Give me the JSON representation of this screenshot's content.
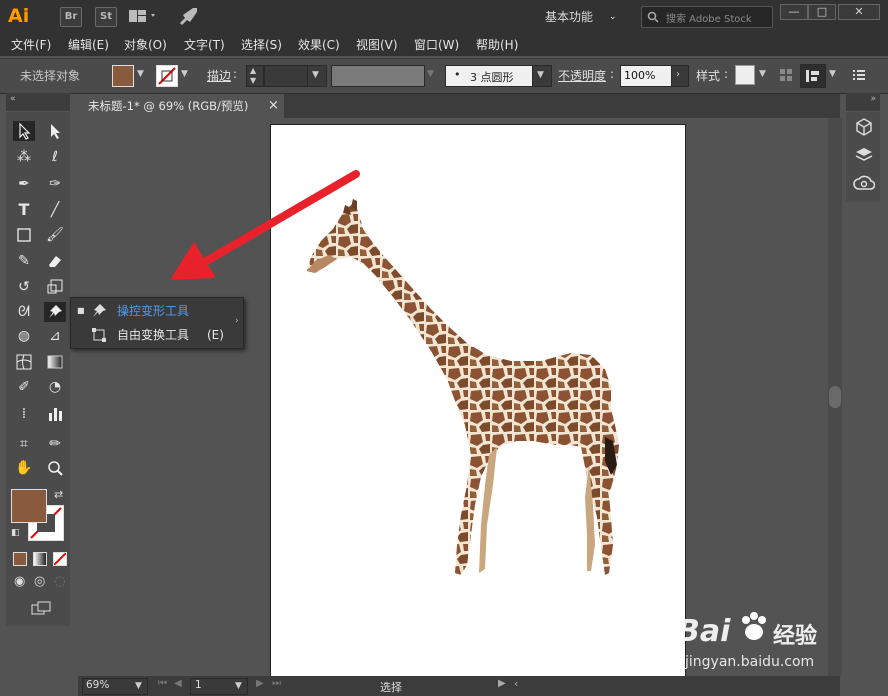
{
  "title_bar": {
    "logo": "Ai",
    "bridge_label": "Br",
    "stock_label": "St",
    "workspace": "基本功能",
    "search_placeholder": "搜索 Adobe Stock",
    "minimize": "—",
    "maximize": "□",
    "close": "✕"
  },
  "menu": [
    "文件(F)",
    "编辑(E)",
    "对象(O)",
    "文字(T)",
    "选择(S)",
    "效果(C)",
    "视图(V)",
    "窗口(W)",
    "帮助(H)"
  ],
  "control_bar": {
    "selection_status": "未选择对象",
    "stroke_label": "描边",
    "brush_label": "3 点圆形",
    "opacity_label": "不透明度",
    "opacity_value": "100%",
    "style_label": "样式",
    "fill_color": "#8a5a3c"
  },
  "document_tab": {
    "title": "未标题-1* @ 69% (RGB/预览)",
    "close": "×"
  },
  "flyout": {
    "items": [
      {
        "label": "操控变形工具",
        "shortcut": "",
        "selected": true
      },
      {
        "label": "自由变换工具",
        "shortcut": "(E)",
        "selected": false
      }
    ]
  },
  "status_bar": {
    "zoom": "69%",
    "page": "1",
    "mode": "选择"
  },
  "tools": {
    "fill_color": "#8a5a3c"
  },
  "watermark": {
    "brand": "Bai",
    "brand2": "经验",
    "url": "jingyan.baidu.com"
  }
}
